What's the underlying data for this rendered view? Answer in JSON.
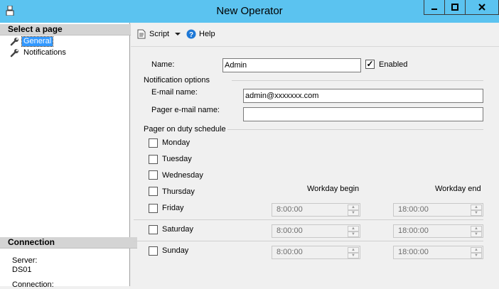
{
  "window": {
    "title": "New Operator"
  },
  "left_panel": {
    "select_page_header": "Select a page",
    "pages": [
      {
        "label": "General",
        "icon": "wrench-icon",
        "selected": true
      },
      {
        "label": "Notifications",
        "icon": "wrench-icon",
        "selected": false
      }
    ],
    "connection_header": "Connection",
    "server_label": "Server:",
    "server_value": "DS01",
    "connection_label": "Connection:"
  },
  "toolbar": {
    "script_label": "Script",
    "help_label": "Help"
  },
  "general": {
    "name_label": "Name:",
    "name_value": "Admin",
    "enabled_label": "Enabled",
    "enabled_checked": true,
    "notification_options_label": "Notification options",
    "email_name_label": "E-mail name:",
    "email_name_value": "admin@xxxxxxx.com",
    "pager_email_label": "Pager e-mail name:",
    "pager_email_value": "",
    "pager_schedule_label": "Pager on duty schedule",
    "workday_begin_label": "Workday begin",
    "workday_end_label": "Workday end",
    "days": [
      {
        "label": "Monday",
        "checked": false
      },
      {
        "label": "Tuesday",
        "checked": false
      },
      {
        "label": "Wednesday",
        "checked": false
      },
      {
        "label": "Thursday",
        "checked": false
      },
      {
        "label": "Friday",
        "checked": false,
        "begin": "8:00:00",
        "end": "18:00:00"
      },
      {
        "label": "Saturday",
        "checked": false,
        "begin": "8:00:00",
        "end": "18:00:00"
      },
      {
        "label": "Sunday",
        "checked": false,
        "begin": "8:00:00",
        "end": "18:00:00"
      }
    ]
  }
}
